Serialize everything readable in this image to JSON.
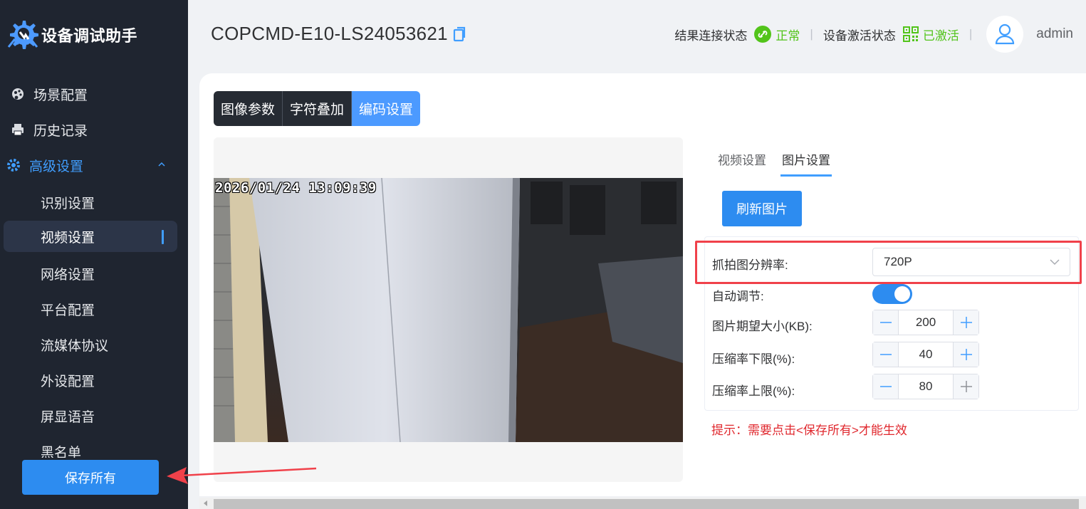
{
  "app": {
    "name": "设备调试助手"
  },
  "sidebar": {
    "items": [
      {
        "label": "场景配置",
        "icon": "palette-icon"
      },
      {
        "label": "历史记录",
        "icon": "printer-icon"
      },
      {
        "label": "高级设置",
        "icon": "gear-icon",
        "expanded": true
      }
    ],
    "sub_items": [
      {
        "label": "识别设置"
      },
      {
        "label": "视频设置",
        "selected": true
      },
      {
        "label": "网络设置"
      },
      {
        "label": "平台配置"
      },
      {
        "label": "流媒体协议"
      },
      {
        "label": "外设配置"
      },
      {
        "label": "屏显语音"
      },
      {
        "label": "黑名单"
      }
    ],
    "save_label": "保存所有"
  },
  "header": {
    "device_id": "COPCMD-E10-LS24053621",
    "connection_label": "结果连接状态",
    "connection_value": "正常",
    "activation_label": "设备激活状态",
    "activation_value": "已激活",
    "user": "admin"
  },
  "main": {
    "tabs": [
      "图像参数",
      "字符叠加",
      "编码设置"
    ],
    "active_tab": "编码设置",
    "preview": {
      "timestamp": "2026/01/24 13:09:39"
    },
    "subtabs": [
      "视频设置",
      "图片设置"
    ],
    "active_subtab": "图片设置",
    "refresh_label": "刷新图片",
    "form": {
      "resolution_label": "抓拍图分辨率:",
      "resolution_value": "720P",
      "auto_adjust_label": "自动调节:",
      "auto_adjust_on": true,
      "size_label": "图片期望大小(KB):",
      "size_value": "200",
      "min_label": "压缩率下限(%):",
      "min_value": "40",
      "max_label": "压缩率上限(%):",
      "max_value": "80"
    },
    "hint": "提示：需要点击<保存所有>才能生效"
  },
  "colors": {
    "accent": "#2d8cf0",
    "sidebar_bg": "#1f2530",
    "ok_green": "#52c41a",
    "warn_red": "#e0282e"
  }
}
